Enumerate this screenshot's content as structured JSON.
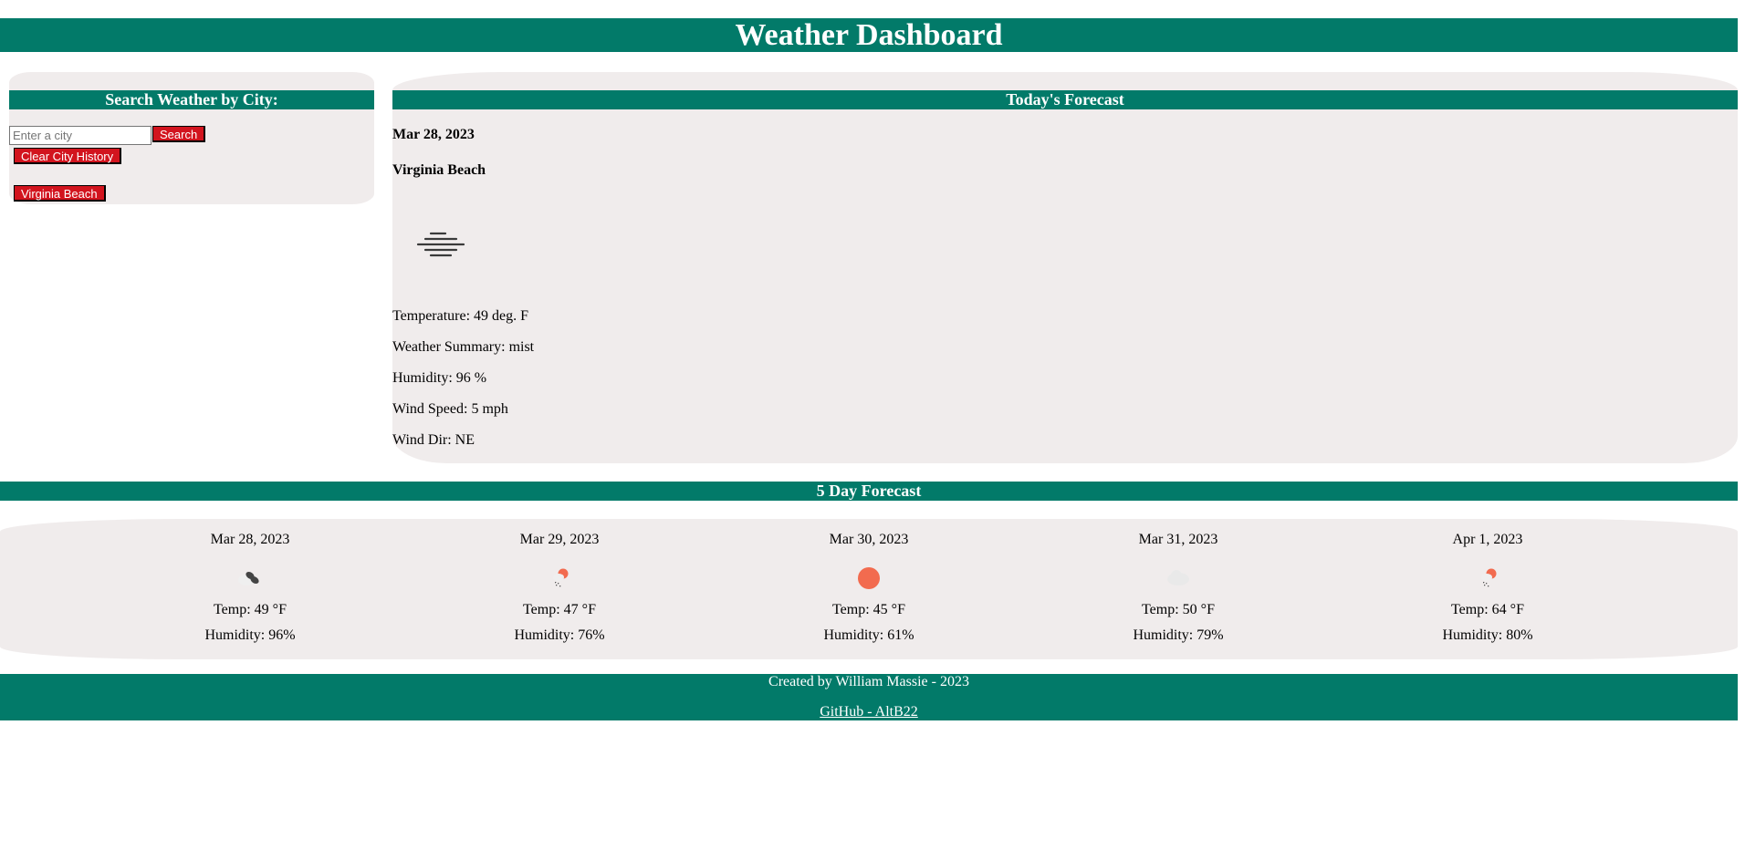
{
  "header": {
    "title": "Weather Dashboard"
  },
  "search": {
    "title": "Search Weather by City:",
    "input_value": "",
    "input_placeholder": "Enter a city",
    "search_label": "Search",
    "clear_label": "Clear City History",
    "history": [
      "Virginia Beach"
    ]
  },
  "today": {
    "title": "Today's Forecast",
    "date": "Mar 28, 2023",
    "city": "Virginia Beach",
    "icon": "mist-icon",
    "temperature": "Temperature: 49 deg. F",
    "summary": "Weather Summary: mist",
    "humidity": "Humidity: 96 %",
    "wind_speed": "Wind Speed: 5 mph",
    "wind_dir": "Wind Dir: NE"
  },
  "five_day": {
    "title": "5 Day Forecast",
    "days": [
      {
        "date": "Mar 28, 2023",
        "icon": "broken-clouds-icon",
        "temp": "Temp: 49 °F",
        "humidity": "Humidity: 96%"
      },
      {
        "date": "Mar 29, 2023",
        "icon": "rain-sun-icon",
        "temp": "Temp: 47 °F",
        "humidity": "Humidity: 76%"
      },
      {
        "date": "Mar 30, 2023",
        "icon": "sun-icon",
        "temp": "Temp: 45 °F",
        "humidity": "Humidity: 61%"
      },
      {
        "date": "Mar 31, 2023",
        "icon": "cloud-icon",
        "temp": "Temp: 50 °F",
        "humidity": "Humidity: 79%"
      },
      {
        "date": "Apr 1, 2023",
        "icon": "rain-sun-icon",
        "temp": "Temp: 64 °F",
        "humidity": "Humidity: 80%"
      }
    ]
  },
  "footer": {
    "credit": "Created by William Massie - 2023",
    "github_label": "GitHub - AltB22"
  },
  "colors": {
    "brand": "#027a69",
    "panel": "#f0ecec",
    "button": "#d2141e"
  }
}
